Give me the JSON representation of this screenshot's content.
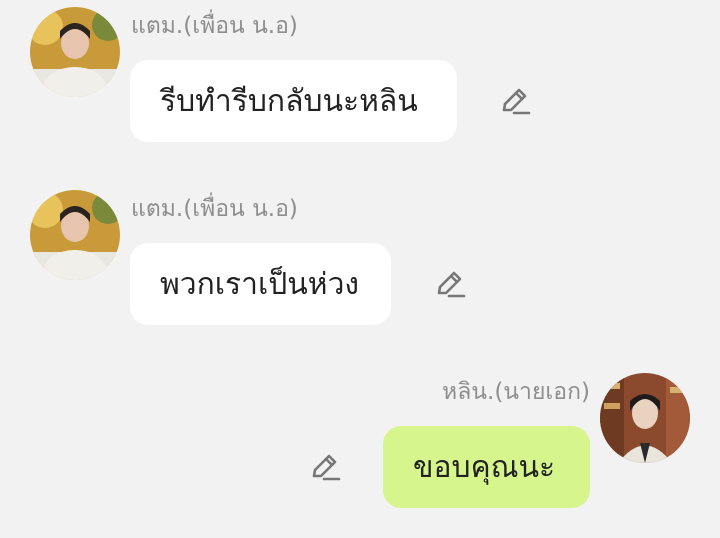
{
  "messages": [
    {
      "sender": "แตม.(เพื่อน น.อ)",
      "text": "รีบทำรีบกลับนะหลิน",
      "side": "left",
      "edit_icon": "pencil-icon"
    },
    {
      "sender": "แตม.(เพื่อน น.อ)",
      "text": "พวกเราเป็นห่วง",
      "side": "left",
      "edit_icon": "pencil-icon"
    },
    {
      "sender": "หลิน.(นายเอก)",
      "text": "ขอบคุณนะ",
      "side": "right",
      "edit_icon": "pencil-icon"
    }
  ],
  "colors": {
    "background": "#f2f2f2",
    "incoming_bubble": "#ffffff",
    "outgoing_bubble": "#d6f58c",
    "sender_name": "#8e8e8e"
  }
}
